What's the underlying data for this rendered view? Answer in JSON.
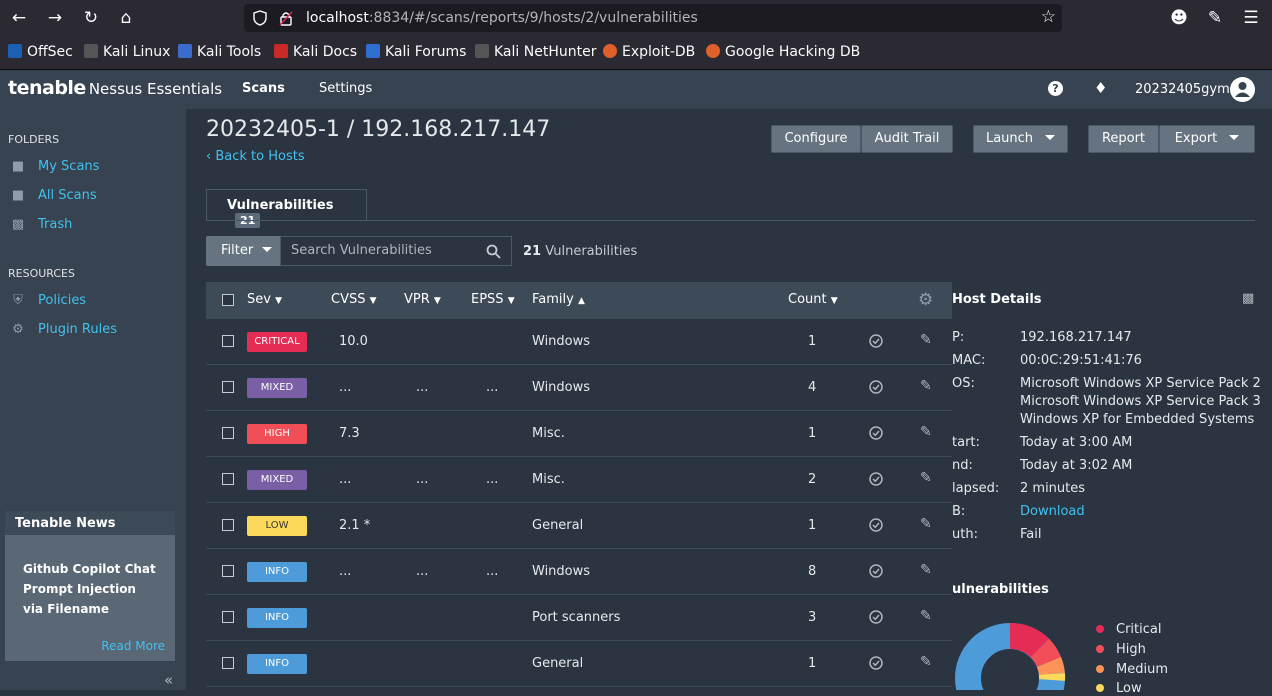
{
  "browser": {
    "url_host": "localhost",
    "url_rest": ":8834/#/scans/reports/9/hosts/2/vulnerabilities",
    "bookmarks": [
      "OffSec",
      "Kali Linux",
      "Kali Tools",
      "Kali Docs",
      "Kali Forums",
      "Kali NetHunter",
      "Exploit-DB",
      "Google Hacking DB"
    ]
  },
  "header": {
    "logo_main": "tenable",
    "logo_sub": "Nessus Essentials",
    "nav_scans": "Scans",
    "nav_settings": "Settings",
    "username": "20232405gym"
  },
  "sidebar": {
    "folders_heading": "FOLDERS",
    "folders": [
      "My Scans",
      "All Scans",
      "Trash"
    ],
    "resources_heading": "RESOURCES",
    "resources": [
      "Policies",
      "Plugin Rules"
    ],
    "news_heading": "Tenable News",
    "news_text": "Github Copilot Chat Prompt Injection via Filename",
    "news_more": "Read More"
  },
  "main": {
    "title": "20232405-1 / 192.168.217.147",
    "back": "Back to Hosts",
    "buttons": {
      "configure": "Configure",
      "audit": "Audit Trail",
      "launch": "Launch",
      "report": "Report",
      "export": "Export"
    },
    "tab_label": "Vulnerabilities",
    "tab_count": "21",
    "filter": "Filter",
    "search_placeholder": "Search Vulnerabilities",
    "count_num": "21",
    "count_text": "Vulnerabilities"
  },
  "table": {
    "headers": {
      "sev": "Sev",
      "cvss": "CVSS",
      "vpr": "VPR",
      "epss": "EPSS",
      "family": "Family",
      "count": "Count"
    },
    "rows": [
      {
        "sev": "CRITICAL",
        "color": "#e42c55",
        "cvss": "10.0",
        "vpr": "",
        "epss": "",
        "family": "Windows",
        "count": "1"
      },
      {
        "sev": "MIXED",
        "color": "#7a5fa6",
        "cvss": "...",
        "vpr": "...",
        "epss": "...",
        "family": "Windows",
        "count": "4"
      },
      {
        "sev": "HIGH",
        "color": "#f14e58",
        "cvss": "7.3",
        "vpr": "",
        "epss": "",
        "family": "Misc.",
        "count": "1"
      },
      {
        "sev": "MIXED",
        "color": "#7a5fa6",
        "cvss": "...",
        "vpr": "...",
        "epss": "...",
        "family": "Misc.",
        "count": "2"
      },
      {
        "sev": "LOW",
        "color": "#fdd95b",
        "cvss": "2.1 *",
        "vpr": "",
        "epss": "",
        "family": "General",
        "count": "1"
      },
      {
        "sev": "INFO",
        "color": "#4d9bd8",
        "cvss": "...",
        "vpr": "...",
        "epss": "...",
        "family": "Windows",
        "count": "8"
      },
      {
        "sev": "INFO",
        "color": "#4d9bd8",
        "cvss": "",
        "vpr": "",
        "epss": "",
        "family": "Port scanners",
        "count": "3"
      },
      {
        "sev": "INFO",
        "color": "#4d9bd8",
        "cvss": "",
        "vpr": "",
        "epss": "",
        "family": "General",
        "count": "1"
      }
    ]
  },
  "host_details": {
    "title": "Host Details",
    "keys": [
      "P:",
      "MAC:",
      "OS:",
      "tart:",
      "nd:",
      "lapsed:",
      "B:",
      "uth:"
    ],
    "ip": "192.168.217.147",
    "mac": "00:0C:29:51:41:76",
    "os1": "Microsoft Windows XP Service Pack 2",
    "os2": "Microsoft Windows XP Service Pack 3",
    "os3": "Windows XP for Embedded Systems",
    "start": "Today at 3:00 AM",
    "end": "Today at 3:02 AM",
    "elapsed": "2 minutes",
    "kb": "Download",
    "auth": "Fail",
    "vuln_title": "ulnerabilities",
    "legend": [
      "Critical",
      "High",
      "Medium",
      "Low"
    ]
  }
}
